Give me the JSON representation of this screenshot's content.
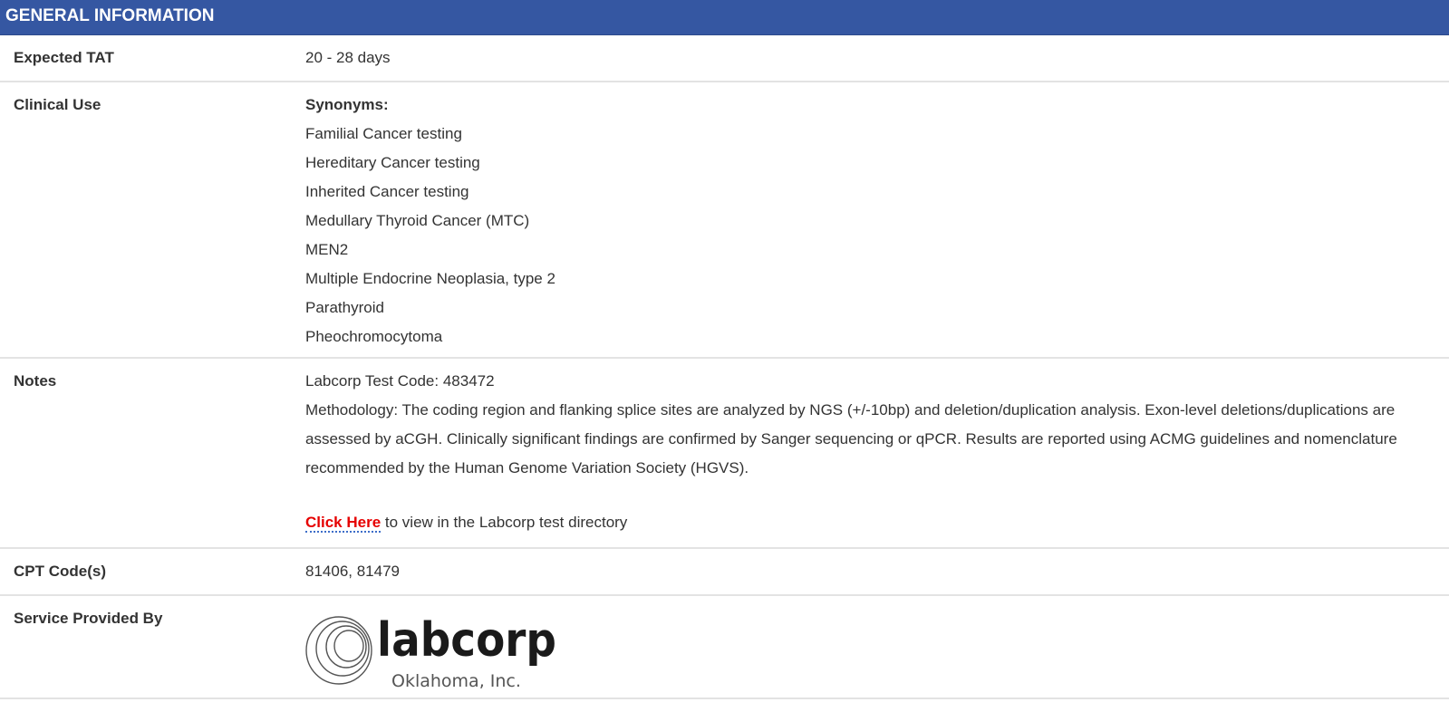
{
  "header": {
    "title": "GENERAL INFORMATION"
  },
  "rows": {
    "tat": {
      "label": "Expected TAT",
      "value": "20 - 28 days"
    },
    "clinical_use": {
      "label": "Clinical Use",
      "synonyms_heading": "Synonyms:",
      "synonyms": [
        "Familial Cancer testing",
        "Hereditary Cancer testing",
        "Inherited Cancer testing",
        "Medullary Thyroid Cancer (MTC)",
        "MEN2",
        "Multiple Endocrine Neoplasia, type 2",
        "Parathyroid",
        "Pheochromocytoma"
      ]
    },
    "notes": {
      "label": "Notes",
      "test_code": "Labcorp Test Code: 483472",
      "methodology": "Methodology: The coding region and flanking splice sites are analyzed by NGS (+/-10bp) and deletion/duplication analysis. Exon-level deletions/duplications are assessed by aCGH. Clinically significant findings are confirmed by Sanger sequencing or qPCR. Results are reported using ACMG guidelines and nomenclature recommended by the Human Genome Variation Society (HGVS).",
      "link_label": "Click Here",
      "link_suffix": " to view in the Labcorp test directory"
    },
    "cpt": {
      "label": "CPT Code(s)",
      "value": "81406, 81479"
    },
    "service": {
      "label": "Service Provided By",
      "logo_wordmark": "labcorp",
      "logo_subtitle": "Oklahoma, Inc."
    }
  },
  "colors": {
    "header_bg": "#3557a2",
    "link": "#e60000",
    "row_divider": "#e3e3e3"
  },
  "icons": {
    "logo_mark": "labcorp-rings-logo"
  }
}
